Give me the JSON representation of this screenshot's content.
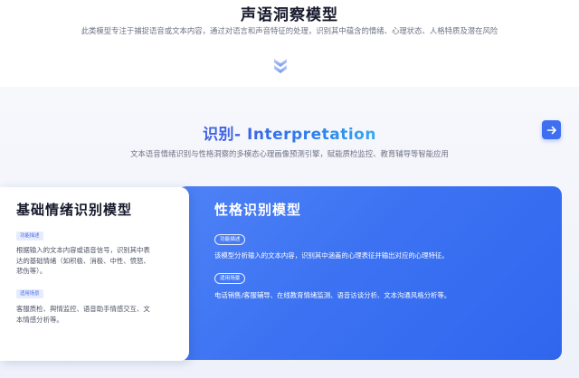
{
  "top": {
    "title": "声语洞察模型",
    "description": "此类模型专注于捕捉语音或文本内容，通过对语言和声音特征的处理，识别其中蕴含的情绪、心理状态、人格特质及潜在风险"
  },
  "section": {
    "title_cn": "识别-",
    "title_en": " Interpretation",
    "description": "文本语音情绪识别与性格洞察的多模态心理画像预测引擎，赋能质检监控、教育辅导等智能应用"
  },
  "cards": {
    "basic": {
      "title": "基础情绪识别模型",
      "func_tag": "功能描述",
      "func_lines": [
        "根据输入的文本内容或语音信号，识别其中表",
        "达的基础情绪（如积极、消极、中性、愤怒、",
        "悲伤等）。"
      ],
      "scene_tag": "适用场景",
      "scene_lines": [
        "客服质检、舆情监控、语音助手情感交互、文",
        "本情感分析等。"
      ]
    },
    "personality": {
      "title": "性格识别模型",
      "func_tag": "功能描述",
      "func_text": "该模型分析输入的文本内容，识别其中涵盖的心理表征并输出对应的心理特征。",
      "scene_tag": "适用场景",
      "scene_text": "电话销售/客服辅导、在线教育情绪监测、语音访谈分析、文本沟通风格分析等。"
    }
  },
  "colors": {
    "accent": "#3f6ff0",
    "blue_card_start": "#4e82f6",
    "blue_card_end": "#2f66ee",
    "tag_bg": "#e6ecfd"
  },
  "icons": {
    "scroll_down": "double-chevron-down-icon",
    "next": "arrow-right-icon"
  }
}
